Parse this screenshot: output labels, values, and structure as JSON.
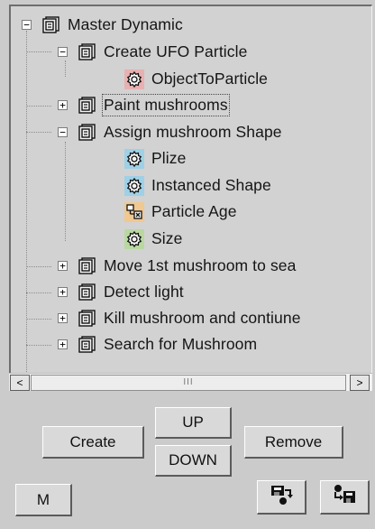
{
  "tree": {
    "nodes": [
      {
        "label": "Master Dynamic",
        "expander": "−",
        "icon": "event-icon"
      },
      {
        "label": "Create UFO Particle",
        "expander": "−",
        "icon": "event-icon"
      },
      {
        "label": "ObjectToParticle",
        "expander": "",
        "icon": "gear-operator-icon"
      },
      {
        "label": "Paint mushrooms",
        "expander": "+",
        "icon": "event-icon"
      },
      {
        "label": "Assign mushroom Shape",
        "expander": "−",
        "icon": "event-icon"
      },
      {
        "label": "Plize",
        "expander": "",
        "icon": "gear-operator-icon"
      },
      {
        "label": "Instanced Shape",
        "expander": "",
        "icon": "gear-operator-icon"
      },
      {
        "label": "Particle Age",
        "expander": "",
        "icon": "age-test-icon"
      },
      {
        "label": "Size",
        "expander": "",
        "icon": "gear-operator-icon"
      },
      {
        "label": "Move 1st mushroom to sea",
        "expander": "+",
        "icon": "event-icon"
      },
      {
        "label": "Detect light",
        "expander": "+",
        "icon": "event-icon"
      },
      {
        "label": "Kill mushroom and contiune",
        "expander": "+",
        "icon": "event-icon"
      },
      {
        "label": "Search for Mushroom",
        "expander": "+",
        "icon": "event-icon"
      }
    ],
    "selected_label": "Paint mushrooms"
  },
  "scrollbar": {
    "left_arrow": "<",
    "right_arrow": ">",
    "thumb_grip": "III"
  },
  "buttons": {
    "up": "UP",
    "down": "DOWN",
    "create": "Create",
    "remove": "Remove",
    "m": "M"
  },
  "icons": {
    "load": "load-file-icon",
    "save": "save-file-icon"
  },
  "colors": {
    "gear_highlight_red": "#e8b0b0",
    "gear_highlight_blue": "#9ed0e6",
    "gear_highlight_orange": "#f0c890",
    "gear_highlight_green": "#b8d8a0"
  }
}
